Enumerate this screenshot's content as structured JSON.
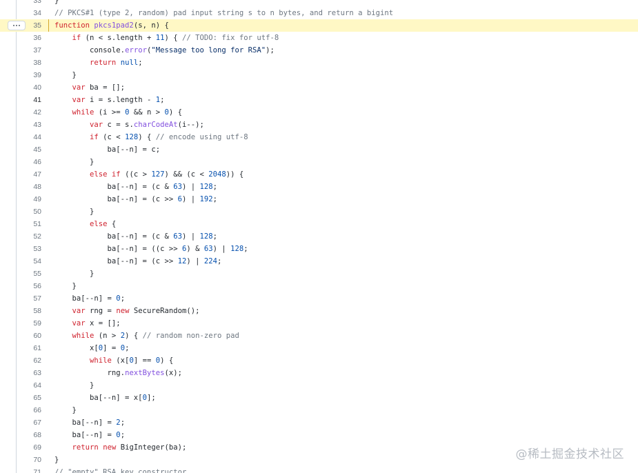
{
  "file_view": {
    "highlighted_line": 35,
    "current_line": 41,
    "more_button_label": "•••",
    "lines": [
      {
        "n": 33,
        "tokens": [
          [
            "txt",
            "}"
          ]
        ]
      },
      {
        "n": 34,
        "tokens": [
          [
            "cm",
            "// PKCS#1 (type 2, random) pad input string s to n bytes, and return a bigint"
          ]
        ]
      },
      {
        "n": 35,
        "tokens": [
          [
            "kw",
            "function "
          ],
          [
            "fn",
            "pkcs1pad2"
          ],
          [
            "txt",
            "(s, n) {"
          ]
        ]
      },
      {
        "n": 36,
        "tokens": [
          [
            "txt",
            "    "
          ],
          [
            "kw",
            "if"
          ],
          [
            "txt",
            " (n < s.length + "
          ],
          [
            "num",
            "11"
          ],
          [
            "txt",
            ") { "
          ],
          [
            "cm",
            "// TODO: fix for utf-8"
          ]
        ]
      },
      {
        "n": 37,
        "tokens": [
          [
            "txt",
            "        console."
          ],
          [
            "fn",
            "error"
          ],
          [
            "txt",
            "("
          ],
          [
            "str",
            "\"Message too long for RSA\""
          ],
          [
            "txt",
            ");"
          ]
        ]
      },
      {
        "n": 38,
        "tokens": [
          [
            "txt",
            "        "
          ],
          [
            "kw",
            "return"
          ],
          [
            "txt",
            " "
          ],
          [
            "num",
            "null"
          ],
          [
            "txt",
            ";"
          ]
        ]
      },
      {
        "n": 39,
        "tokens": [
          [
            "txt",
            "    }"
          ]
        ]
      },
      {
        "n": 40,
        "tokens": [
          [
            "txt",
            "    "
          ],
          [
            "kw",
            "var"
          ],
          [
            "txt",
            " ba = [];"
          ]
        ]
      },
      {
        "n": 41,
        "tokens": [
          [
            "txt",
            "    "
          ],
          [
            "kw",
            "var"
          ],
          [
            "txt",
            " i = s.length - "
          ],
          [
            "num",
            "1"
          ],
          [
            "txt",
            ";"
          ]
        ]
      },
      {
        "n": 42,
        "tokens": [
          [
            "txt",
            "    "
          ],
          [
            "kw",
            "while"
          ],
          [
            "txt",
            " (i >= "
          ],
          [
            "num",
            "0"
          ],
          [
            "txt",
            " && n > "
          ],
          [
            "num",
            "0"
          ],
          [
            "txt",
            ") {"
          ]
        ]
      },
      {
        "n": 43,
        "tokens": [
          [
            "txt",
            "        "
          ],
          [
            "kw",
            "var"
          ],
          [
            "txt",
            " c = s."
          ],
          [
            "fn",
            "charCodeAt"
          ],
          [
            "txt",
            "(i--);"
          ]
        ]
      },
      {
        "n": 44,
        "tokens": [
          [
            "txt",
            "        "
          ],
          [
            "kw",
            "if"
          ],
          [
            "txt",
            " (c < "
          ],
          [
            "num",
            "128"
          ],
          [
            "txt",
            ") { "
          ],
          [
            "cm",
            "// encode using utf-8"
          ]
        ]
      },
      {
        "n": 45,
        "tokens": [
          [
            "txt",
            "            ba[--n] = c;"
          ]
        ]
      },
      {
        "n": 46,
        "tokens": [
          [
            "txt",
            "        }"
          ]
        ]
      },
      {
        "n": 47,
        "tokens": [
          [
            "txt",
            "        "
          ],
          [
            "kw",
            "else if"
          ],
          [
            "txt",
            " ((c > "
          ],
          [
            "num",
            "127"
          ],
          [
            "txt",
            ") && (c < "
          ],
          [
            "num",
            "2048"
          ],
          [
            "txt",
            ")) {"
          ]
        ]
      },
      {
        "n": 48,
        "tokens": [
          [
            "txt",
            "            ba[--n] = (c & "
          ],
          [
            "num",
            "63"
          ],
          [
            "txt",
            ") | "
          ],
          [
            "num",
            "128"
          ],
          [
            "txt",
            ";"
          ]
        ]
      },
      {
        "n": 49,
        "tokens": [
          [
            "txt",
            "            ba[--n] = (c >> "
          ],
          [
            "num",
            "6"
          ],
          [
            "txt",
            ") | "
          ],
          [
            "num",
            "192"
          ],
          [
            "txt",
            ";"
          ]
        ]
      },
      {
        "n": 50,
        "tokens": [
          [
            "txt",
            "        }"
          ]
        ]
      },
      {
        "n": 51,
        "tokens": [
          [
            "txt",
            "        "
          ],
          [
            "kw",
            "else"
          ],
          [
            "txt",
            " {"
          ]
        ]
      },
      {
        "n": 52,
        "tokens": [
          [
            "txt",
            "            ba[--n] = (c & "
          ],
          [
            "num",
            "63"
          ],
          [
            "txt",
            ") | "
          ],
          [
            "num",
            "128"
          ],
          [
            "txt",
            ";"
          ]
        ]
      },
      {
        "n": 53,
        "tokens": [
          [
            "txt",
            "            ba[--n] = ((c >> "
          ],
          [
            "num",
            "6"
          ],
          [
            "txt",
            ") & "
          ],
          [
            "num",
            "63"
          ],
          [
            "txt",
            ") | "
          ],
          [
            "num",
            "128"
          ],
          [
            "txt",
            ";"
          ]
        ]
      },
      {
        "n": 54,
        "tokens": [
          [
            "txt",
            "            ba[--n] = (c >> "
          ],
          [
            "num",
            "12"
          ],
          [
            "txt",
            ") | "
          ],
          [
            "num",
            "224"
          ],
          [
            "txt",
            ";"
          ]
        ]
      },
      {
        "n": 55,
        "tokens": [
          [
            "txt",
            "        }"
          ]
        ]
      },
      {
        "n": 56,
        "tokens": [
          [
            "txt",
            "    }"
          ]
        ]
      },
      {
        "n": 57,
        "tokens": [
          [
            "txt",
            "    ba[--n] = "
          ],
          [
            "num",
            "0"
          ],
          [
            "txt",
            ";"
          ]
        ]
      },
      {
        "n": 58,
        "tokens": [
          [
            "txt",
            "    "
          ],
          [
            "kw",
            "var"
          ],
          [
            "txt",
            " rng = "
          ],
          [
            "kw",
            "new"
          ],
          [
            "txt",
            " SecureRandom();"
          ]
        ]
      },
      {
        "n": 59,
        "tokens": [
          [
            "txt",
            "    "
          ],
          [
            "kw",
            "var"
          ],
          [
            "txt",
            " x = [];"
          ]
        ]
      },
      {
        "n": 60,
        "tokens": [
          [
            "txt",
            "    "
          ],
          [
            "kw",
            "while"
          ],
          [
            "txt",
            " (n > "
          ],
          [
            "num",
            "2"
          ],
          [
            "txt",
            ") { "
          ],
          [
            "cm",
            "// random non-zero pad"
          ]
        ]
      },
      {
        "n": 61,
        "tokens": [
          [
            "txt",
            "        x["
          ],
          [
            "num",
            "0"
          ],
          [
            "txt",
            "] = "
          ],
          [
            "num",
            "0"
          ],
          [
            "txt",
            ";"
          ]
        ]
      },
      {
        "n": 62,
        "tokens": [
          [
            "txt",
            "        "
          ],
          [
            "kw",
            "while"
          ],
          [
            "txt",
            " (x["
          ],
          [
            "num",
            "0"
          ],
          [
            "txt",
            "] == "
          ],
          [
            "num",
            "0"
          ],
          [
            "txt",
            ") {"
          ]
        ]
      },
      {
        "n": 63,
        "tokens": [
          [
            "txt",
            "            rng."
          ],
          [
            "fn",
            "nextBytes"
          ],
          [
            "txt",
            "(x);"
          ]
        ]
      },
      {
        "n": 64,
        "tokens": [
          [
            "txt",
            "        }"
          ]
        ]
      },
      {
        "n": 65,
        "tokens": [
          [
            "txt",
            "        ba[--n] = x["
          ],
          [
            "num",
            "0"
          ],
          [
            "txt",
            "];"
          ]
        ]
      },
      {
        "n": 66,
        "tokens": [
          [
            "txt",
            "    }"
          ]
        ]
      },
      {
        "n": 67,
        "tokens": [
          [
            "txt",
            "    ba[--n] = "
          ],
          [
            "num",
            "2"
          ],
          [
            "txt",
            ";"
          ]
        ]
      },
      {
        "n": 68,
        "tokens": [
          [
            "txt",
            "    ba[--n] = "
          ],
          [
            "num",
            "0"
          ],
          [
            "txt",
            ";"
          ]
        ]
      },
      {
        "n": 69,
        "tokens": [
          [
            "txt",
            "    "
          ],
          [
            "kw",
            "return"
          ],
          [
            "txt",
            " "
          ],
          [
            "kw",
            "new"
          ],
          [
            "txt",
            " BigInteger(ba);"
          ]
        ]
      },
      {
        "n": 70,
        "tokens": [
          [
            "txt",
            "}"
          ]
        ]
      },
      {
        "n": 71,
        "tokens": [
          [
            "cm",
            "// \"empty\" RSA key constructor"
          ]
        ]
      }
    ]
  },
  "watermark": {
    "text": "@稀土掘金技术社区"
  },
  "colors": {
    "highlight_background": "#fff8c5",
    "keyword": "#cf222e",
    "function_name": "#8250df",
    "comment": "#6e7781",
    "number": "#0550ae",
    "string": "#0a3069"
  }
}
